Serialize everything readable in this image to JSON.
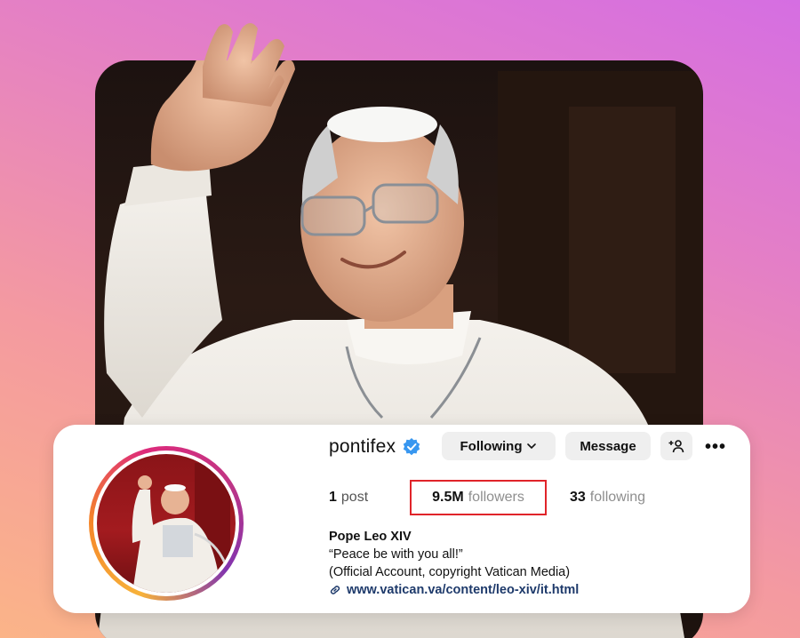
{
  "profile": {
    "username": "pontifex",
    "verified_icon": "verified-badge-icon",
    "buttons": {
      "following_label": "Following",
      "message_label": "Message"
    },
    "stats": {
      "posts_count": "1",
      "posts_label": "post",
      "followers_count": "9.5M",
      "followers_label": "followers",
      "following_count": "33",
      "following_label": "following"
    },
    "bio": {
      "name": "Pope Leo XIV",
      "line1": "“Peace be with you all!”",
      "line2": "(Official Account, copyright Vatican Media)",
      "link": "www.vatican.va/content/leo-xiv/it.html"
    }
  },
  "colors": {
    "accent_highlight": "#e0242a",
    "verified_blue": "#3897f0",
    "link_color": "#1e3a6b"
  }
}
